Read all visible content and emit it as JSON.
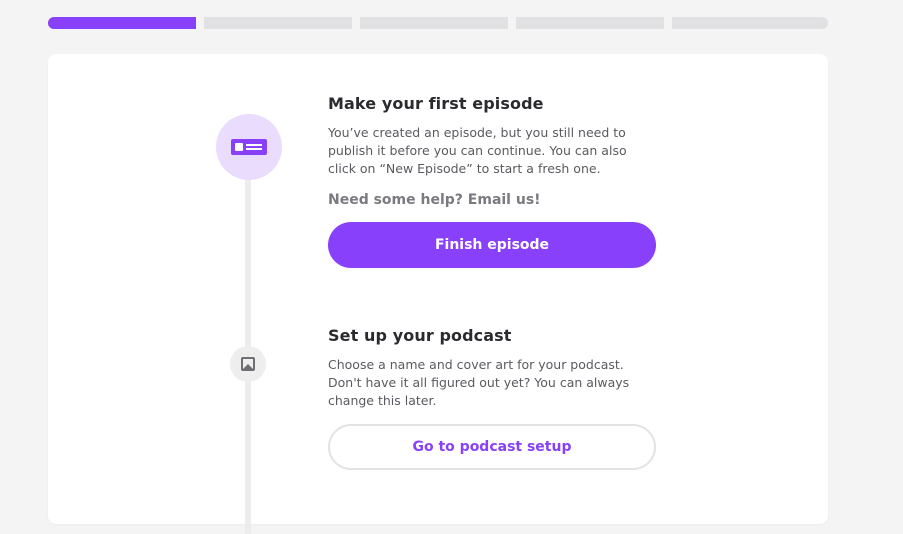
{
  "progress": {
    "total_steps": 5,
    "completed_steps": 1
  },
  "colors": {
    "accent": "#8940fa",
    "accent_light": "#e9dcfd",
    "track": "#e1e1e4"
  },
  "steps": [
    {
      "icon": "episode-icon",
      "title": "Make your first episode",
      "description": "You’ve created an episode, but you still need to publish it before you can continue. You can also click on “New Episode” to start a fresh one.",
      "help": "Need some help? Email us!",
      "button_label": "Finish episode"
    },
    {
      "icon": "image-icon",
      "title": "Set up your podcast",
      "description": "Choose a name and cover art for your podcast. Don't have it all figured out yet? You can always change this later.",
      "button_label": "Go to podcast setup"
    }
  ]
}
